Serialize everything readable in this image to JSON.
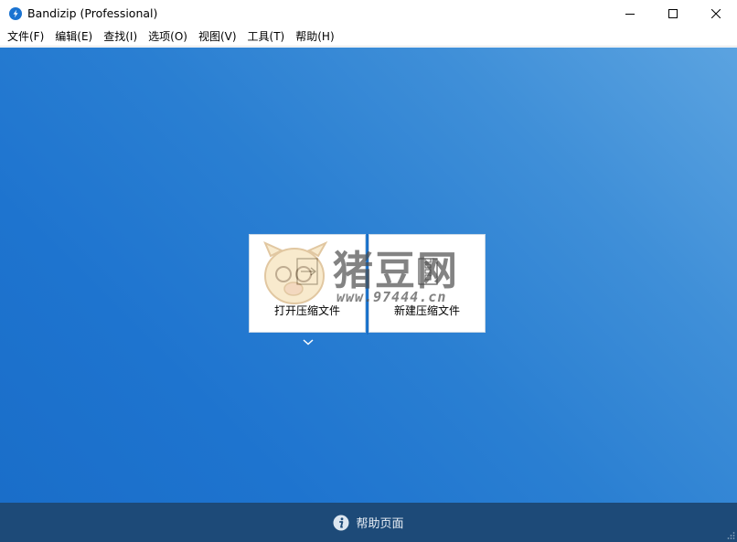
{
  "window": {
    "title": "Bandizip (Professional)",
    "accent_color": "#1a6fc7"
  },
  "menu": {
    "items": [
      {
        "label": "文件(F)"
      },
      {
        "label": "编辑(E)"
      },
      {
        "label": "查找(I)"
      },
      {
        "label": "选项(O)"
      },
      {
        "label": "视图(V)"
      },
      {
        "label": "工具(T)"
      },
      {
        "label": "帮助(H)"
      }
    ]
  },
  "actions": {
    "open_archive_label": "打开压缩文件",
    "new_archive_label": "新建压缩文件",
    "open_icon": "open-archive-icon",
    "new_icon": "new-archive-icon"
  },
  "watermark": {
    "text": "猪豆网",
    "url": "www.97444.cn"
  },
  "footer": {
    "help_label": "帮助页面",
    "help_icon": "info-icon",
    "background": "#1d4a78"
  }
}
